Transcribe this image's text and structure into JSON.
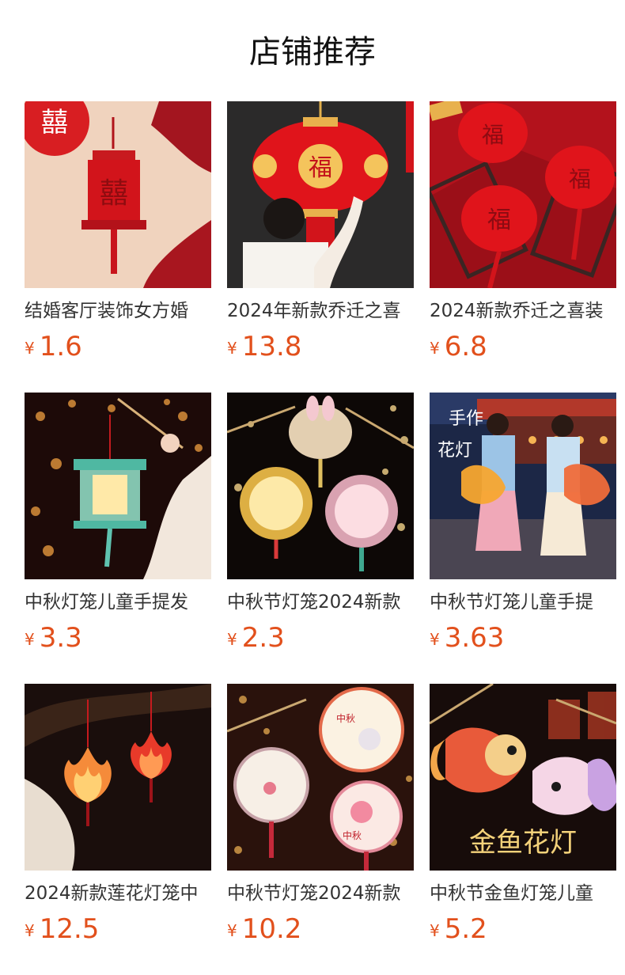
{
  "page": {
    "title": "店铺推荐"
  },
  "currency_symbol": "¥",
  "products": [
    {
      "name": "结婚客厅装饰女方婚",
      "price": "1.6",
      "image": "red-double-happiness-lantern"
    },
    {
      "name": "2024年新款乔迁之喜",
      "price": "13.8",
      "image": "big-red-fu-lantern"
    },
    {
      "name": "2024新款乔迁之喜装",
      "price": "6.8",
      "image": "red-fu-lanterns-set"
    },
    {
      "name": "中秋灯笼儿童手提发",
      "price": "3.3",
      "image": "green-palace-lantern"
    },
    {
      "name": "中秋节灯笼2024新款",
      "price": "2.3",
      "image": "rabbit-glowing-lanterns"
    },
    {
      "name": "中秋节灯笼儿童手提",
      "price": "3.63",
      "image": "butterfly-lanterns-girls"
    },
    {
      "name": "2024新款莲花灯笼中",
      "price": "12.5",
      "image": "lotus-lanterns"
    },
    {
      "name": "中秋节灯笼2024新款",
      "price": "10.2",
      "image": "round-painted-lanterns"
    },
    {
      "name": "中秋节金鱼灯笼儿童",
      "price": "5.2",
      "image": "goldfish-lanterns"
    }
  ],
  "image_texts": {
    "hand_made": "手作花灯",
    "goldfish": "金鱼花灯",
    "mid_autumn": "中秋"
  },
  "colors": {
    "price": "#e2501c",
    "lantern_red": "#d2141b",
    "gold": "#f2c15a"
  }
}
